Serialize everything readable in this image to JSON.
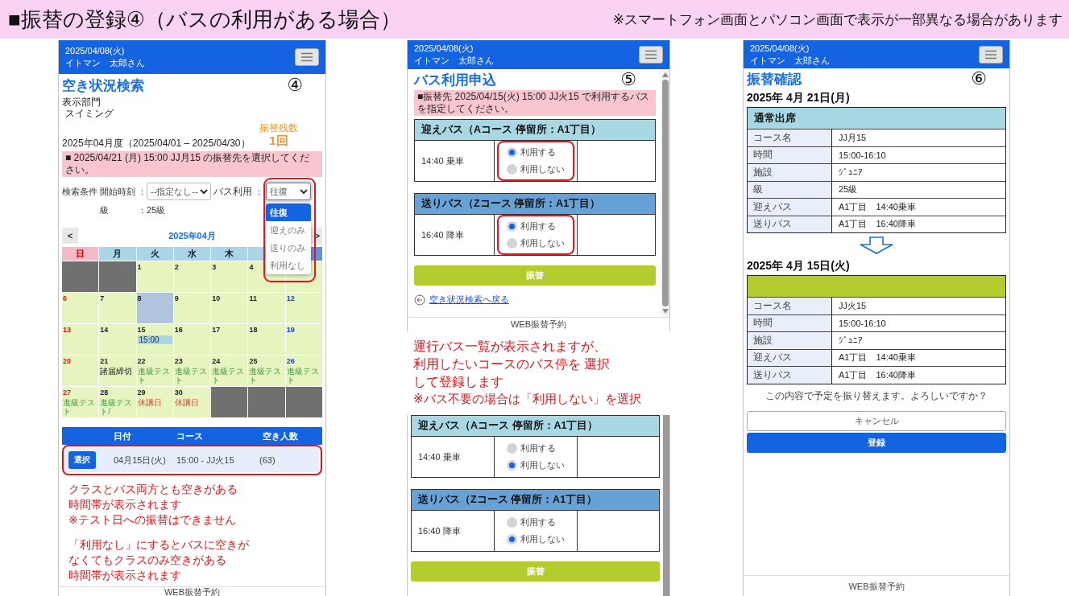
{
  "slide": {
    "title": "■振替の登録④（バスの利用がある場合）",
    "note": "※スマートフォン画面とパソコン画面で表示が一部異なる場合があります"
  },
  "screen_search": {
    "step": "④",
    "header": {
      "date": "2025/04/08(火)",
      "user": "イトマン　太郎さん"
    },
    "title": "空き状況検索",
    "department_label": "表示部門",
    "department": "スイミング",
    "period": "2025年04月度（2025/04/01 – 2025/04/30）",
    "remaining_label": "振替残数",
    "remaining": "1回",
    "notice": "■ 2025/04/21 (月) 15:00 JJ月15 の振替先を選択してください。",
    "filters": {
      "label": "検索条件",
      "start_time": {
        "label": "開始時刻",
        "separator": "：",
        "value": "--指定なし--"
      },
      "bus": {
        "label": "バス利用",
        "separator": "：",
        "value": "往復",
        "highlighted": true,
        "expanded": true,
        "options": [
          {
            "label": "往復",
            "selected": true
          },
          {
            "label": "迎えのみ",
            "selected": false
          },
          {
            "label": "送りのみ",
            "selected": false
          },
          {
            "label": "利用なし",
            "selected": false
          }
        ]
      },
      "grade": {
        "label": "級",
        "separator": "：",
        "value": "25級"
      }
    },
    "calendar": {
      "prev": "<",
      "month": "2025年04月",
      "next": ">",
      "weekdays": [
        {
          "label": "日",
          "kind": "sunday"
        },
        {
          "label": "月",
          "kind": "weekday"
        },
        {
          "label": "火",
          "kind": "weekday"
        },
        {
          "label": "水",
          "kind": "weekday"
        },
        {
          "label": "木",
          "kind": "weekday"
        },
        {
          "kind": "weekday"
        },
        {
          "kind": "saturday"
        }
      ],
      "weeks": [
        [
          {
            "kind": "blank"
          },
          {
            "kind": "blank"
          },
          {
            "kind": "day",
            "day": "1"
          },
          {
            "kind": "day",
            "day": "2"
          },
          {
            "kind": "day",
            "day": "3"
          },
          {
            "kind": "day",
            "day": "4"
          },
          {
            "kind": "day"
          }
        ],
        [
          {
            "kind": "day",
            "day": "6"
          },
          {
            "kind": "day",
            "day": "7"
          },
          {
            "kind": "today",
            "day": "8"
          },
          {
            "kind": "day",
            "day": "9"
          },
          {
            "kind": "day",
            "day": "10"
          },
          {
            "kind": "day",
            "day": "11"
          },
          {
            "kind": "day",
            "day": "12"
          }
        ],
        [
          {
            "kind": "day",
            "day": "13"
          },
          {
            "kind": "day",
            "day": "14"
          },
          {
            "kind": "day",
            "day": "15",
            "events": [
              {
                "kind": "slot",
                "text": "15:00"
              }
            ]
          },
          {
            "kind": "day",
            "day": "16"
          },
          {
            "kind": "day",
            "day": "17"
          },
          {
            "kind": "day",
            "day": "18"
          },
          {
            "kind": "day",
            "day": "19"
          }
        ],
        [
          {
            "kind": "day",
            "day": "20"
          },
          {
            "kind": "day",
            "day": "21",
            "events": [
              {
                "kind": "deadline",
                "text": "諸届締切"
              }
            ]
          },
          {
            "kind": "day",
            "day": "22",
            "events": [
              {
                "kind": "test",
                "text": "進級テスト"
              }
            ]
          },
          {
            "kind": "day",
            "day": "23",
            "events": [
              {
                "kind": "test",
                "text": "進級テスト"
              }
            ]
          },
          {
            "kind": "day",
            "day": "24",
            "events": [
              {
                "kind": "test",
                "text": "進級テスト"
              }
            ]
          },
          {
            "kind": "day",
            "day": "25",
            "events": [
              {
                "kind": "test",
                "text": "進級テスト"
              }
            ]
          },
          {
            "kind": "day",
            "day": "26",
            "events": [
              {
                "kind": "test",
                "text": "進級テスト"
              }
            ]
          }
        ],
        [
          {
            "kind": "day",
            "day": "27",
            "events": [
              {
                "kind": "test",
                "text": "進級テスト"
              }
            ]
          },
          {
            "kind": "day",
            "day": "28",
            "events": [
              {
                "kind": "test",
                "text": "進級テスト/"
              },
              {
                "kind": "marker"
              }
            ]
          },
          {
            "kind": "day",
            "day": "29",
            "events": [
              {
                "kind": "closed",
                "text": "休講日"
              }
            ]
          },
          {
            "kind": "day",
            "day": "30",
            "events": [
              {
                "kind": "closed",
                "text": "休講日"
              }
            ]
          },
          {
            "kind": "blank"
          },
          {
            "kind": "blank"
          },
          {
            "kind": "blank"
          }
        ]
      ]
    },
    "results": {
      "columns": [
        "日付",
        "コース",
        "空き人数"
      ],
      "rows": [
        {
          "button": "選択",
          "date": "04月15日(火)",
          "course": "15:00 - JJ火15",
          "vacancy": "(63)",
          "highlighted": true
        }
      ]
    },
    "annotations": [
      [
        "クラスとバス両方とも空きがある",
        "時間帯が表示されます",
        "※テスト日への振替はできません"
      ],
      [
        "「利用なし」にするとバスに空きが",
        "なくてもクラスのみ空きがある",
        "時間帯が表示されます"
      ]
    ],
    "footer": "WEB振替予約"
  },
  "screen_bus": {
    "step": "⑤",
    "header": {
      "date": "2025/04/08(火)",
      "user": "イトマン　太郎さん"
    },
    "title": "バス利用申込",
    "notice": "■振替先 2025/04/15(火) 15:00 JJ火15 で利用するバスを指定してください。",
    "buses": [
      {
        "kind": "pickup",
        "title": "迎えバス（Aコース 停留所：A1丁目）",
        "time": "14:40 乗車",
        "highlighted": true,
        "options": [
          {
            "label": "利用する",
            "selected": true
          },
          {
            "label": "利用しない",
            "selected": false
          }
        ]
      },
      {
        "kind": "dropoff",
        "title": "送りバス（Zコース 停留所：A1丁目）",
        "time": "16:40 降車",
        "highlighted": true,
        "options": [
          {
            "label": "利用する",
            "selected": true
          },
          {
            "label": "利用しない",
            "selected": false
          }
        ]
      }
    ],
    "submit": "振替",
    "back_link": "空き状況検索へ戻る",
    "footer": "WEB振替予約"
  },
  "annotation_bus": [
    "運行バス一覧が表示されますが、",
    "利用したいコースのバス停を 選択",
    "して登録します",
    "※バス不要の場合は「利用しない」を選択"
  ],
  "screen_bus_none": {
    "buses": [
      {
        "kind": "pickup",
        "title": "迎えバス（Aコース 停留所：A1丁目）",
        "time": "14:40 乗車",
        "highlighted": false,
        "options": [
          {
            "label": "利用する",
            "selected": false
          },
          {
            "label": "利用しない",
            "selected": true
          }
        ]
      },
      {
        "kind": "dropoff",
        "title": "送りバス（Zコース 停留所：A1丁目）",
        "time": "16:40 降車",
        "highlighted": false,
        "options": [
          {
            "label": "利用する",
            "selected": false
          },
          {
            "label": "利用しない",
            "selected": true
          }
        ]
      }
    ],
    "submit": "振替"
  },
  "screen_confirm": {
    "step": "⑥",
    "header": {
      "date": "2025/04/08(火)",
      "user": "イトマン　太郎さん"
    },
    "title": "振替確認",
    "sections": [
      {
        "date": "2025年 4月 21日(月)",
        "kind": "current",
        "heading": "通常出席",
        "rows": [
          {
            "label": "コース名",
            "value": "JJ月15"
          },
          {
            "label": "時間",
            "value": "15:00-16:10"
          },
          {
            "label": "施設",
            "value": "ｼﾞｭﾆｱ"
          },
          {
            "label": "級",
            "value": "25級"
          },
          {
            "label": "迎えバス",
            "value": "A1丁目　14:40乗車"
          },
          {
            "label": "送りバス",
            "value": "A1丁目　16:40降車"
          }
        ]
      },
      {
        "date": "2025年 4月 15日(火)",
        "kind": "new",
        "rows": [
          {
            "label": "コース名",
            "value": "JJ火15"
          },
          {
            "label": "時間",
            "value": "15:00-16:10"
          },
          {
            "label": "施設",
            "value": "ｼﾞｭﾆｱ"
          },
          {
            "label": "迎えバス",
            "value": "A1丁目　14:40乗車"
          },
          {
            "label": "送りバス",
            "value": "A1丁目　16:40降車"
          }
        ]
      }
    ],
    "confirm_text": "この内容で予定を振り替えます。よろしいですか？",
    "cancel": "キャンセル",
    "register": "登録",
    "footer": "WEB振替予約"
  }
}
